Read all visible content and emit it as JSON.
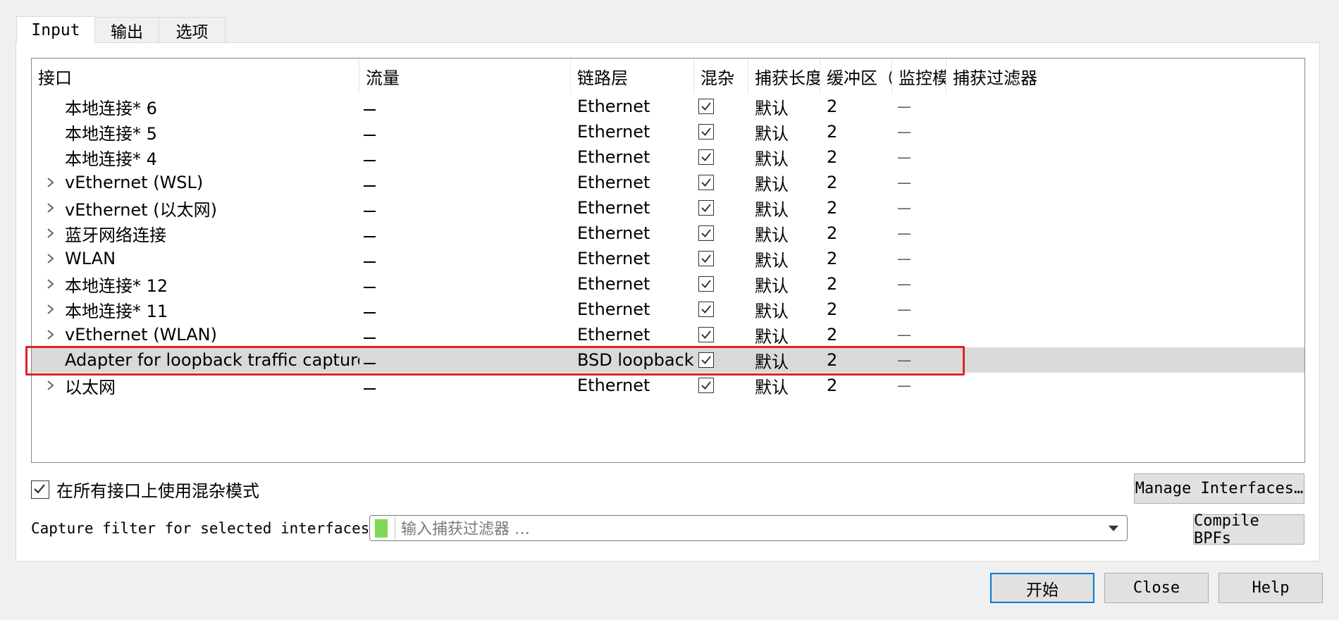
{
  "tabs": [
    {
      "label": "Input",
      "active": true
    },
    {
      "label": "输出",
      "active": false
    },
    {
      "label": "选项",
      "active": false
    }
  ],
  "columns": [
    "接口",
    "流量",
    "链路层",
    "混杂",
    "捕获长度",
    "缓冲区（",
    "监控模式",
    "捕获过滤器"
  ],
  "interfaces": [
    {
      "name": "本地连接* 6",
      "expandable": false,
      "link": "Ethernet",
      "promiscuous": true,
      "snaplen": "默认",
      "buffer": "2",
      "monitor": "—",
      "selected": false
    },
    {
      "name": "本地连接* 5",
      "expandable": false,
      "link": "Ethernet",
      "promiscuous": true,
      "snaplen": "默认",
      "buffer": "2",
      "monitor": "—",
      "selected": false
    },
    {
      "name": "本地连接* 4",
      "expandable": false,
      "link": "Ethernet",
      "promiscuous": true,
      "snaplen": "默认",
      "buffer": "2",
      "monitor": "—",
      "selected": false
    },
    {
      "name": "vEthernet (WSL)",
      "expandable": true,
      "link": "Ethernet",
      "promiscuous": true,
      "snaplen": "默认",
      "buffer": "2",
      "monitor": "—",
      "selected": false
    },
    {
      "name": "vEthernet (以太网)",
      "expandable": true,
      "link": "Ethernet",
      "promiscuous": true,
      "snaplen": "默认",
      "buffer": "2",
      "monitor": "—",
      "selected": false
    },
    {
      "name": "蓝牙网络连接",
      "expandable": true,
      "link": "Ethernet",
      "promiscuous": true,
      "snaplen": "默认",
      "buffer": "2",
      "monitor": "—",
      "selected": false
    },
    {
      "name": "WLAN",
      "expandable": true,
      "link": "Ethernet",
      "promiscuous": true,
      "snaplen": "默认",
      "buffer": "2",
      "monitor": "—",
      "selected": false
    },
    {
      "name": "本地连接* 12",
      "expandable": true,
      "link": "Ethernet",
      "promiscuous": true,
      "snaplen": "默认",
      "buffer": "2",
      "monitor": "—",
      "selected": false
    },
    {
      "name": "本地连接* 11",
      "expandable": true,
      "link": "Ethernet",
      "promiscuous": true,
      "snaplen": "默认",
      "buffer": "2",
      "monitor": "—",
      "selected": false
    },
    {
      "name": "vEthernet (WLAN)",
      "expandable": true,
      "link": "Ethernet",
      "promiscuous": true,
      "snaplen": "默认",
      "buffer": "2",
      "monitor": "—",
      "selected": false
    },
    {
      "name": "Adapter for loopback traffic capture",
      "expandable": false,
      "link": "BSD loopback",
      "promiscuous": true,
      "snaplen": "默认",
      "buffer": "2",
      "monitor": "—",
      "selected": true
    },
    {
      "name": "以太网",
      "expandable": true,
      "link": "Ethernet",
      "promiscuous": true,
      "snaplen": "默认",
      "buffer": "2",
      "monitor": "—",
      "selected": false
    }
  ],
  "promisc_all_label": "在所有接口上使用混杂模式",
  "manage_button": "Manage Interfaces…",
  "filter_label": "Capture filter for selected interfaces:",
  "filter_placeholder": "输入捕获过滤器 …",
  "compile_button": "Compile BPFs",
  "start_button": "开始",
  "close_button": "Close",
  "help_button": "Help",
  "colors": {
    "selected_row": "#d9d9d9",
    "highlight_border": "#e0202a",
    "bookmark": "#7ed957"
  }
}
